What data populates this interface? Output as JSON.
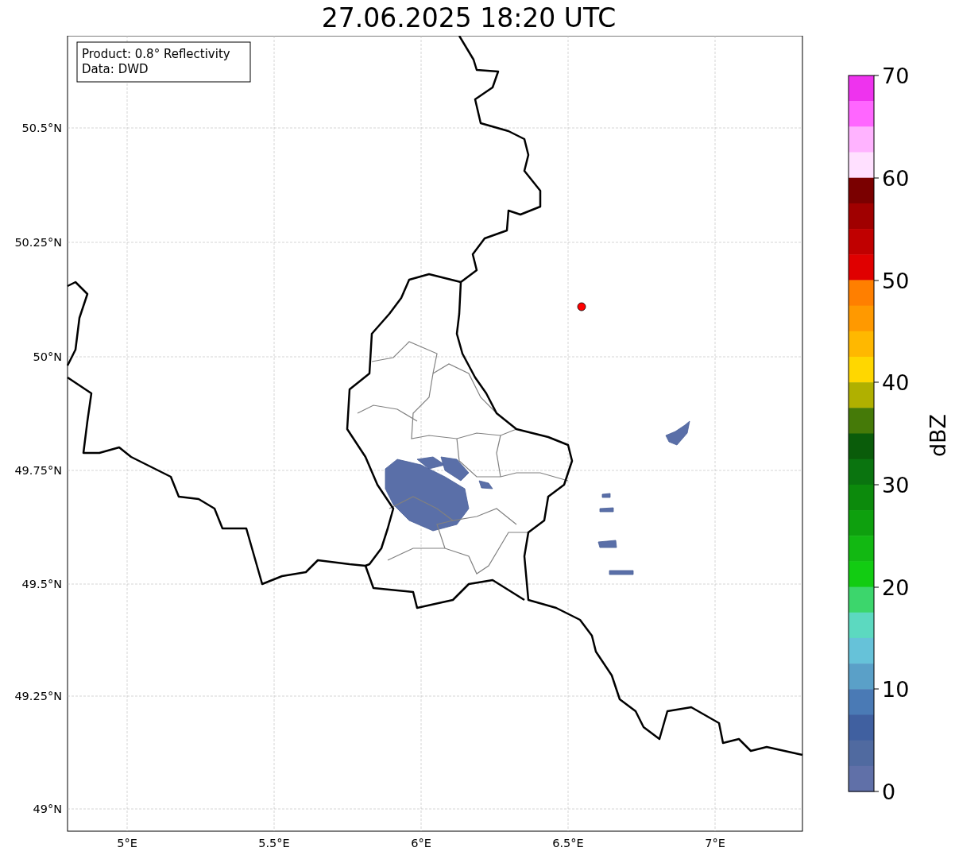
{
  "title": "27.06.2025 18:20 UTC",
  "info_box": [
    "Product: 0.8° Reflectivity",
    "Data: DWD"
  ],
  "map": {
    "lat_labels": [
      "50.5°N",
      "50.25°N",
      "50°N",
      "49.75°N",
      "49.5°N",
      "49.25°N",
      "49°N"
    ],
    "lon_labels": [
      "5°E",
      "5.5°E",
      "6°E",
      "6.5°E",
      "7°E"
    ]
  },
  "colorbar": {
    "label": "dBZ",
    "ticks": [
      "70",
      "60",
      "50",
      "40",
      "30",
      "20",
      "10",
      "0"
    ],
    "segments": [
      {
        "color": "#ee33ee"
      },
      {
        "color": "#ff66ff"
      },
      {
        "color": "#ffb3ff"
      },
      {
        "color": "#ffe0ff"
      },
      {
        "color": "#7a0000"
      },
      {
        "color": "#a00000"
      },
      {
        "color": "#c00000"
      },
      {
        "color": "#e00000"
      },
      {
        "color": "#ff7f00"
      },
      {
        "color": "#ff9900"
      },
      {
        "color": "#ffb800"
      },
      {
        "color": "#ffd700"
      },
      {
        "color": "#b0b000"
      },
      {
        "color": "#457a08"
      },
      {
        "color": "#0a5c0a"
      },
      {
        "color": "#0a740f"
      },
      {
        "color": "#0c8a0c"
      },
      {
        "color": "#0ea00e"
      },
      {
        "color": "#12b812"
      },
      {
        "color": "#12cc12"
      },
      {
        "color": "#3cd66c"
      },
      {
        "color": "#5cd9c0"
      },
      {
        "color": "#66c2d9"
      },
      {
        "color": "#5aa0c8"
      },
      {
        "color": "#4a7ab5"
      },
      {
        "color": "#4060a0"
      },
      {
        "color": "#506aa0"
      },
      {
        "color": "#6070a8"
      }
    ]
  }
}
